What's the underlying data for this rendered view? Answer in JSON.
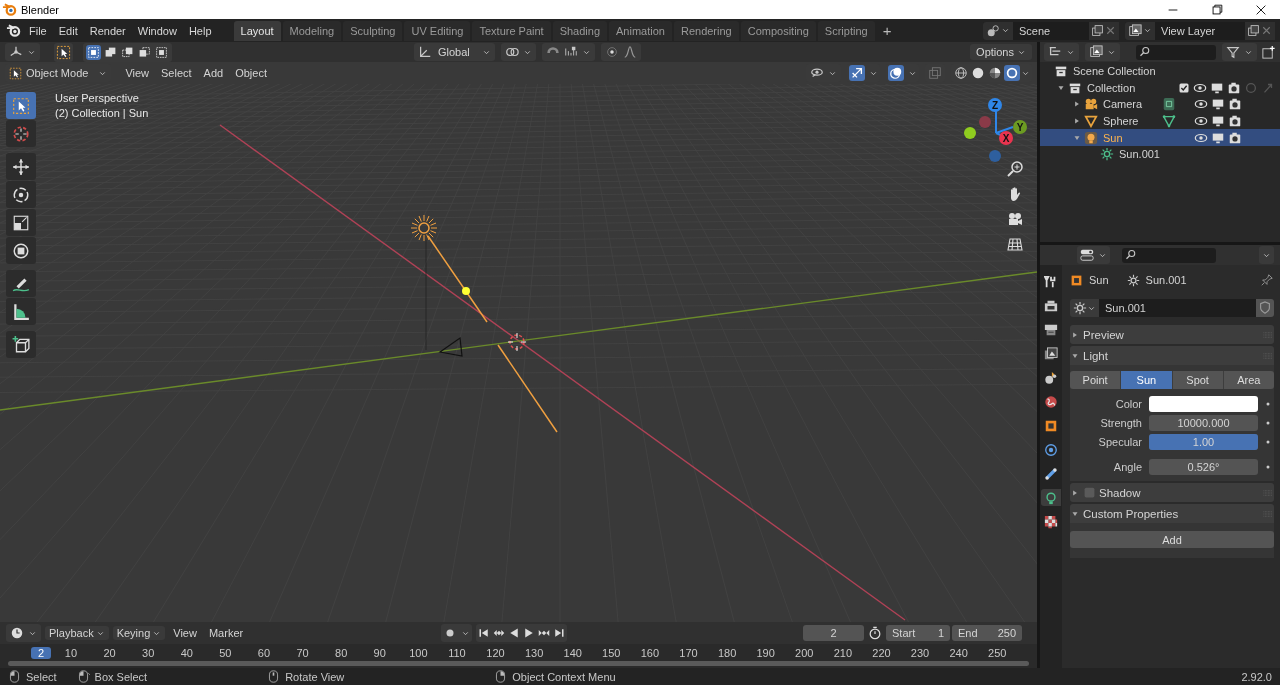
{
  "window": {
    "title": "Blender"
  },
  "menu": [
    "File",
    "Edit",
    "Render",
    "Window",
    "Help"
  ],
  "workspaces": [
    {
      "label": "Layout",
      "selected": true
    },
    {
      "label": "Modeling",
      "selected": false
    },
    {
      "label": "Sculpting",
      "selected": false
    },
    {
      "label": "UV Editing",
      "selected": false
    },
    {
      "label": "Texture Paint",
      "selected": false
    },
    {
      "label": "Shading",
      "selected": false
    },
    {
      "label": "Animation",
      "selected": false
    },
    {
      "label": "Rendering",
      "selected": false
    },
    {
      "label": "Compositing",
      "selected": false
    },
    {
      "label": "Scripting",
      "selected": false
    }
  ],
  "add_workspace": "+",
  "scene": {
    "value": "Scene"
  },
  "view_layer": {
    "value": "View Layer"
  },
  "viewport_header": {
    "orientation": "Global",
    "options": "Options",
    "select_modes": [
      {
        "kind": "set",
        "selected": true
      },
      {
        "kind": "extend",
        "selected": false
      },
      {
        "kind": "subtract",
        "selected": false
      },
      {
        "kind": "invert",
        "selected": false
      },
      {
        "kind": "intersect",
        "selected": false
      }
    ]
  },
  "viewport_menu": {
    "mode": "Object Mode",
    "items": [
      "View",
      "Select",
      "Add",
      "Object"
    ],
    "toggles": [
      {
        "kind": "gizmos",
        "on": true
      },
      {
        "kind": "overlays",
        "on": true
      },
      {
        "kind": "xray",
        "on": false
      }
    ],
    "shading": [
      {
        "kind": "wireframe",
        "selected": false
      },
      {
        "kind": "solid",
        "selected": false
      },
      {
        "kind": "material",
        "selected": false
      },
      {
        "kind": "rendered",
        "selected": true
      }
    ]
  },
  "viewport": {
    "perspective": "User Perspective",
    "context": "(2) Collection | Sun",
    "gizmo": [
      "Z",
      "Y",
      "X"
    ],
    "tools": [
      {
        "kind": "select",
        "selected": true
      },
      {
        "kind": "cursor",
        "selected": false
      },
      {
        "kind": "move",
        "selected": false
      },
      {
        "kind": "rotate",
        "selected": false
      },
      {
        "kind": "scale",
        "selected": false
      },
      {
        "kind": "transform",
        "selected": false
      },
      {
        "kind": "annotate",
        "selected": false
      },
      {
        "kind": "measure",
        "selected": false
      },
      {
        "kind": "add_cube",
        "selected": false
      }
    ]
  },
  "outliner": {
    "root": "Scene Collection",
    "tree": [
      {
        "name": "Collection",
        "kind": "collection",
        "expanded": true,
        "selected": false,
        "checked": true,
        "children": [
          {
            "name": "Camera",
            "kind": "camera",
            "expanded": false,
            "selected": false
          },
          {
            "name": "Sphere",
            "kind": "mesh",
            "expanded": false,
            "selected": false
          },
          {
            "name": "Sun",
            "kind": "light",
            "expanded": true,
            "selected": true,
            "children": [
              {
                "name": "Sun.001",
                "kind": "light_data",
                "selected": false
              }
            ]
          }
        ]
      }
    ]
  },
  "properties": {
    "tabs": [
      {
        "kind": "tool",
        "selected": false
      },
      {
        "kind": "render",
        "selected": false
      },
      {
        "kind": "output",
        "selected": false
      },
      {
        "kind": "view_layer",
        "selected": false
      },
      {
        "kind": "scene",
        "selected": false
      },
      {
        "kind": "world",
        "selected": false
      },
      {
        "kind": "object",
        "selected": false
      },
      {
        "kind": "physics",
        "selected": false
      },
      {
        "kind": "constraints",
        "selected": false
      },
      {
        "kind": "data",
        "selected": true
      },
      {
        "kind": "texture",
        "selected": false
      }
    ],
    "breadcrumb": [
      "Sun",
      "Sun.001"
    ],
    "datablock": "Sun.001",
    "sections": [
      {
        "title": "Preview",
        "expanded": false
      },
      {
        "title": "Light",
        "expanded": true,
        "light_types": [
          {
            "label": "Point",
            "selected": false
          },
          {
            "label": "Sun",
            "selected": true
          },
          {
            "label": "Spot",
            "selected": false
          },
          {
            "label": "Area",
            "selected": false
          }
        ],
        "fields": [
          {
            "kind": "color",
            "label": "Color",
            "color": "#ffffff"
          },
          {
            "kind": "number",
            "label": "Strength",
            "value": "10000.000"
          },
          {
            "kind": "slider",
            "label": "Specular",
            "value": "1.00",
            "level": 1
          },
          {
            "kind": "number",
            "label": "Angle",
            "value": "0.526°"
          }
        ]
      },
      {
        "title": "Shadow",
        "expanded": false,
        "checked": false
      },
      {
        "title": "Custom Properties",
        "expanded": true,
        "button": "Add"
      }
    ]
  },
  "timeline": {
    "menus": [
      "Playback",
      "Keying",
      "View",
      "Marker"
    ],
    "current_frame": "2",
    "start_label": "Start",
    "start": "1",
    "end_label": "End",
    "end": "250",
    "ruler_current": "2",
    "ruler": [
      "10",
      "20",
      "30",
      "40",
      "50",
      "60",
      "70",
      "80",
      "90",
      "100",
      "110",
      "120",
      "130",
      "140",
      "150",
      "160",
      "170",
      "180",
      "190",
      "200",
      "210",
      "220",
      "230",
      "240",
      "250"
    ]
  },
  "status_bar": {
    "hints": [
      {
        "kind": "mouse_left",
        "label": "Select"
      },
      {
        "kind": "mouse_drag",
        "label": "Box Select"
      },
      {
        "kind": "mouse_middle",
        "label": "Rotate View"
      },
      {
        "kind": "mouse_right",
        "label": "Object Context Menu"
      }
    ],
    "version": "2.92.0"
  }
}
